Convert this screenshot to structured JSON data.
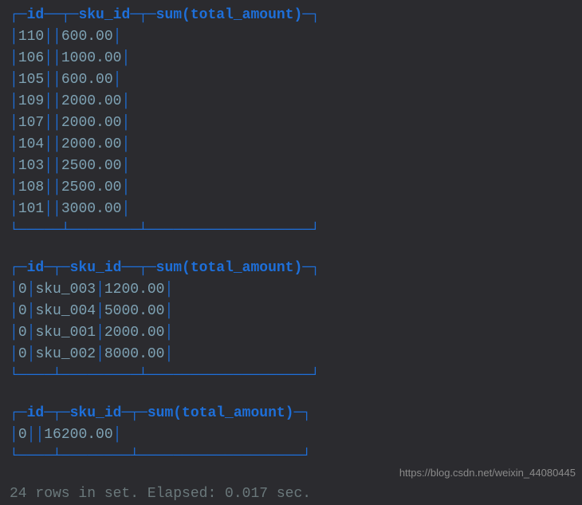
{
  "tables": [
    {
      "headers": [
        "id",
        "sku_id",
        "sum(total_amount)"
      ],
      "rows": [
        [
          "110",
          "",
          "600.00"
        ],
        [
          "106",
          "",
          "1000.00"
        ],
        [
          "105",
          "",
          "600.00"
        ],
        [
          "109",
          "",
          "2000.00"
        ],
        [
          "107",
          "",
          "2000.00"
        ],
        [
          "104",
          "",
          "2000.00"
        ],
        [
          "103",
          "",
          "2500.00"
        ],
        [
          "108",
          "",
          "2500.00"
        ],
        [
          "101",
          "",
          "3000.00"
        ]
      ]
    },
    {
      "headers": [
        "id",
        "sku_id",
        "sum(total_amount)"
      ],
      "rows": [
        [
          "0",
          "sku_003",
          "1200.00"
        ],
        [
          "0",
          "sku_004",
          "5000.00"
        ],
        [
          "0",
          "sku_001",
          "2000.00"
        ],
        [
          "0",
          "sku_002",
          "8000.00"
        ]
      ]
    },
    {
      "headers": [
        "id",
        "sku_id",
        "sum(total_amount)"
      ],
      "rows": [
        [
          "0",
          "",
          "16200.00"
        ]
      ]
    }
  ],
  "status_line": "24 rows in set. Elapsed: 0.017 sec.",
  "watermark": "https://blog.csdn.net/weixin_44080445",
  "chart_data": {
    "type": "table",
    "tables": [
      {
        "columns": [
          "id",
          "sku_id",
          "sum(total_amount)"
        ],
        "data": [
          [
            110,
            null,
            600.0
          ],
          [
            106,
            null,
            1000.0
          ],
          [
            105,
            null,
            600.0
          ],
          [
            109,
            null,
            2000.0
          ],
          [
            107,
            null,
            2000.0
          ],
          [
            104,
            null,
            2000.0
          ],
          [
            103,
            null,
            2500.0
          ],
          [
            108,
            null,
            2500.0
          ],
          [
            101,
            null,
            3000.0
          ]
        ]
      },
      {
        "columns": [
          "id",
          "sku_id",
          "sum(total_amount)"
        ],
        "data": [
          [
            0,
            "sku_003",
            1200.0
          ],
          [
            0,
            "sku_004",
            5000.0
          ],
          [
            0,
            "sku_001",
            2000.0
          ],
          [
            0,
            "sku_002",
            8000.0
          ]
        ]
      },
      {
        "columns": [
          "id",
          "sku_id",
          "sum(total_amount)"
        ],
        "data": [
          [
            0,
            null,
            16200.0
          ]
        ]
      }
    ]
  }
}
